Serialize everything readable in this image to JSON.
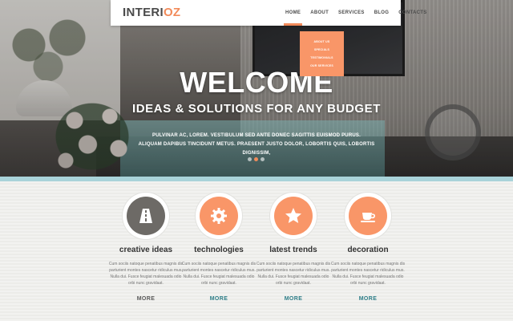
{
  "header": {
    "logo_main": "INTERI",
    "logo_accent": "OZ",
    "nav": [
      {
        "label": "HOME",
        "active": true
      },
      {
        "label": "ABOUT",
        "active": false
      },
      {
        "label": "SERVICES",
        "active": false
      },
      {
        "label": "BLOG",
        "active": false
      },
      {
        "label": "CONTACTS",
        "active": false
      }
    ],
    "dropdown": [
      "ABOUT US",
      "SPECIALS",
      "TESTIMONIALS",
      "OUR SERVICES"
    ]
  },
  "hero": {
    "title": "WELCOME",
    "subtitle": "IDEAS & SOLUTIONS FOR ANY BUDGET",
    "body_line1": "PULVINAR AC, LOREM. VESTIBULUM SED ANTE DONEC SAGITTIS EUISMOD PURUS.",
    "body_line2": "ALIQUAM DAPIBUS TINCIDUNT METUS. PRAESENT JUSTO DOLOR, LOBORTIS QUIS, LOBORTIS DIGNISSIM,",
    "slides": 3,
    "active_slide": 2
  },
  "features": [
    {
      "icon": "road-icon",
      "title": "creative ideas",
      "text": "Cum sociis natoque penatibus magnis dis parturient montes nascetur ridiculus mus. Nulla dui. Fusce feugiat malesuada odio orbi nunc gravidaat.",
      "more": "MORE",
      "more_color": "#5a5a5a"
    },
    {
      "icon": "gear-icon",
      "title": "technologies",
      "text": "Cum sociis natoque penatibus magnis dis parturient montes nascetur ridiculus mus. Nulla dui. Fusce feugiat malesuada odio orbi nunc gravidaat.",
      "more": "MORE",
      "more_color": "#2e7e88"
    },
    {
      "icon": "star-icon",
      "title": "latest trends",
      "text": "Cum sociis natoque penatibus magnis dis parturient montes nascetur ridiculus mus. Nulla dui. Fusce feugiat malesuada odio orbi nunc gravidaat.",
      "more": "MORE",
      "more_color": "#2e7e88"
    },
    {
      "icon": "coffee-cup-icon",
      "title": "decoration",
      "text": "Cum sociis natoque penatibus magnis dis parturient montes nascetur ridiculus mus. Nulla dui. Fusce feugiat malesuada odio orbi nunc gravidaat.",
      "more": "MORE",
      "more_color": "#2e7e88"
    }
  ],
  "colors": {
    "accent": "#f28b5a",
    "icon_dark": "#6d6a66",
    "teal": "#2e7e88"
  }
}
